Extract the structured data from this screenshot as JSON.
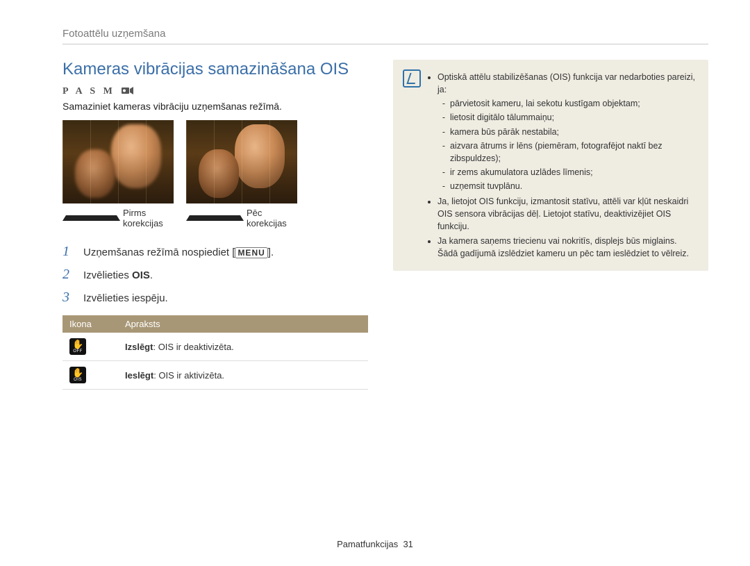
{
  "breadcrumb": "Fotoattēlu uzņemšana",
  "heading": "Kameras vibrācijas samazināšana OIS",
  "modes": "P  A  S  M",
  "intro": "Samaziniet kameras vibrāciju uzņemšanas režīmā.",
  "caption_before": "Pirms korekcijas",
  "caption_after": "Pēc korekcijas",
  "steps": {
    "s1_a": "Uzņemšanas režīmā nospiediet [",
    "s1_menu": "MENU",
    "s1_b": "].",
    "s2_a": "Izvēlieties ",
    "s2_bold": "OIS",
    "s2_b": ".",
    "s3": "Izvēlieties iespēju."
  },
  "table": {
    "th_icon": "Ikona",
    "th_desc": "Apraksts",
    "rows": [
      {
        "sub": "OFF",
        "bold": "Izslēgt",
        "rest": ": OIS ir deaktivizēta."
      },
      {
        "sub": "OIS",
        "bold": "Ieslēgt",
        "rest": ": OIS ir aktivizēta."
      }
    ]
  },
  "note": {
    "lead": "Optiskā attēlu stabilizēšanas (OIS) funkcija var nedarboties pareizi, ja:",
    "subs": [
      "pārvietosit kameru, lai sekotu kustīgam objektam;",
      "lietosit digitālo tālummaiņu;",
      "kamera būs pārāk nestabila;",
      "aizvara ātrums ir lēns (piemēram, fotografējot naktī bez zibspuldzes);",
      "ir zems akumulatora uzlādes līmenis;",
      "uzņemsit tuvplānu."
    ],
    "b2": "Ja, lietojot OIS funkciju, izmantosit statīvu, attēli var kļūt neskaidri OIS sensora vibrācijas dēļ. Lietojot statīvu, deaktivizējiet OIS funkciju.",
    "b3": "Ja kamera saņems triecienu vai nokritīs, displejs būs miglains. Šādā gadījumā izslēdziet kameru un pēc tam ieslēdziet to vēlreiz."
  },
  "footer_label": "Pamatfunkcijas",
  "footer_page": "31"
}
